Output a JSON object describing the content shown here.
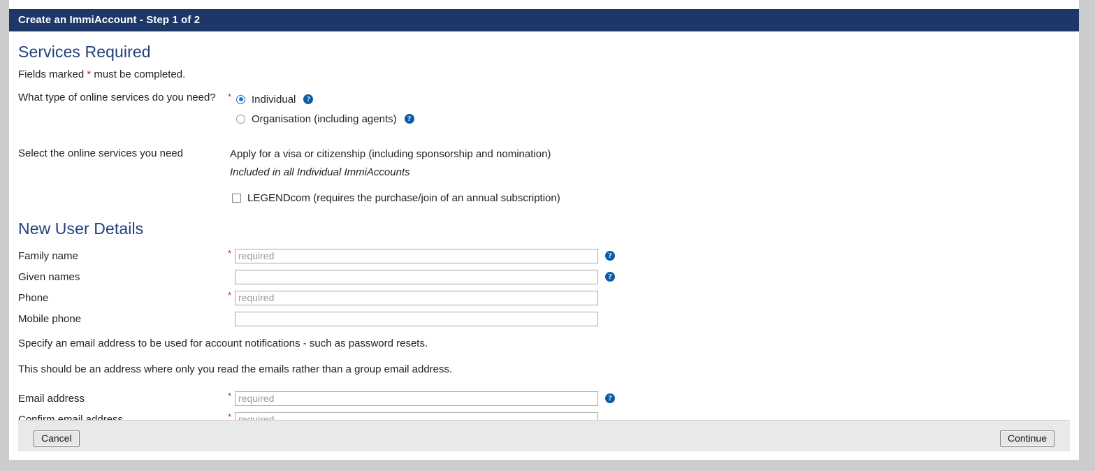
{
  "window": {
    "title": "Create an ImmiAccount - Step 1 of 2"
  },
  "services_section": {
    "heading": "Services Required",
    "fields_note_prefix": "Fields marked ",
    "fields_note_star": "*",
    "fields_note_suffix": " must be completed.",
    "service_type": {
      "label": "What type of online services do you need?",
      "required_star": "*",
      "options": [
        {
          "label": "Individual",
          "selected": true,
          "help_icon": "help-question-icon"
        },
        {
          "label": "Organisation (including agents)",
          "selected": false,
          "help_icon": "help-question-icon"
        }
      ]
    },
    "online_services": {
      "label": "Select the online services you need",
      "included_text": "Apply for a visa or citizenship (including sponsorship and nomination)",
      "included_note": "Included in all Individual ImmiAccounts",
      "checkbox_label": "LEGENDcom (requires the purchase/join of an annual subscription)",
      "checkbox_checked": false
    }
  },
  "user_details_section": {
    "heading": "New User Details",
    "fields": [
      {
        "label": "Family name",
        "required": true,
        "value": "",
        "placeholder": "required",
        "help_icon": "help-question-icon",
        "has_help": true
      },
      {
        "label": "Given names",
        "required": false,
        "value": "",
        "placeholder": "",
        "help_icon": "help-question-icon",
        "has_help": true
      },
      {
        "label": "Phone",
        "required": true,
        "value": "",
        "placeholder": "required",
        "help_icon": "",
        "has_help": false
      },
      {
        "label": "Mobile phone",
        "required": false,
        "value": "",
        "placeholder": "",
        "help_icon": "",
        "has_help": false
      }
    ],
    "email_note_1": "Specify an email address to be used for account notifications - such as password resets.",
    "email_note_2": "This should be an address where only you read the emails rather than a group email address.",
    "email_fields": [
      {
        "label": "Email address",
        "required": true,
        "value": "",
        "placeholder": "required",
        "help_icon": "help-question-icon",
        "has_help": true
      },
      {
        "label": "Confirm email address",
        "required": true,
        "value": "",
        "placeholder": "required",
        "help_icon": "",
        "has_help": false
      }
    ]
  },
  "footer": {
    "cancel_label": "Cancel",
    "continue_label": "Continue"
  },
  "colors": {
    "title_bar": "#1d3768",
    "heading": "#22407a",
    "required_star": "#cc2222",
    "help_icon": "#0b5ca8",
    "footer_band": "#e9e9e9",
    "page_surround": "#cccccc"
  },
  "icons": {
    "help": "?"
  }
}
